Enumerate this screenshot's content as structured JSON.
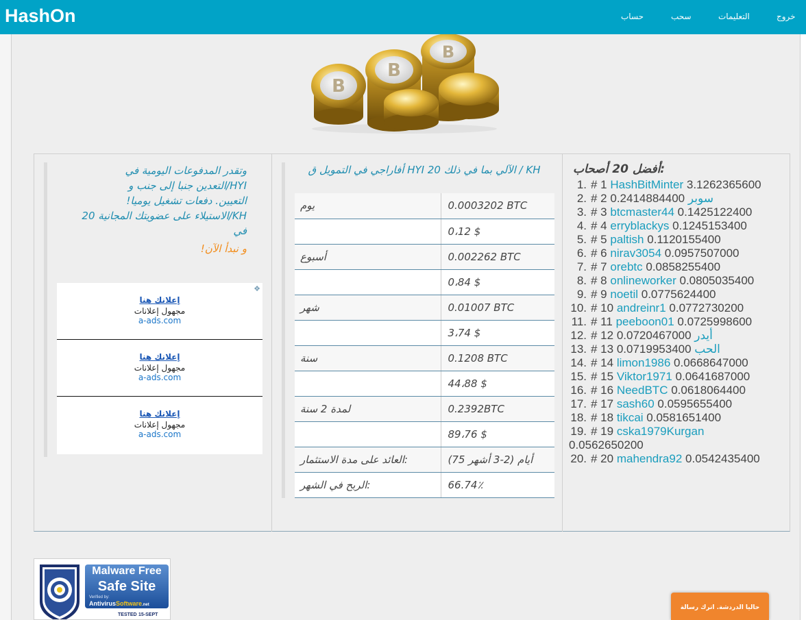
{
  "nav": {
    "brand": "HashOn",
    "links": [
      "خروج",
      "التعليمات",
      "سحب",
      "حساب"
    ]
  },
  "promo": {
    "line1": "وتقدر المدفوعات اليومية في",
    "line2": "HYI/التعدين جنبا إلى جنب و",
    "line3": "التعيين. دفعات تشغيل يوميا!",
    "line4": "KH/الاستيلاء على عضويتك المجانية 20",
    "line5": "في",
    "cta": "و نبدأ الآن!"
  },
  "ads": {
    "items": [
      {
        "title": "إعلانك هنا",
        "subtitle": "مجهول إعلانات",
        "url": "a-ads.com"
      },
      {
        "title": "إعلانك هنا",
        "subtitle": "مجهول إعلانات",
        "url": "a-ads.com"
      },
      {
        "title": "إعلانك هنا",
        "subtitle": "مجهول إعلانات",
        "url": "a-ads.com"
      }
    ]
  },
  "profit": {
    "title": "KH / الآلي بما في ذلك 20 HYI أفاراجي في التمويل ق",
    "rows": [
      {
        "label": "يوم",
        "value": "0.0003202 BTC"
      },
      {
        "label": "",
        "value": "0،12 $"
      },
      {
        "label": "أسبوع",
        "value": "0.002262 BTC"
      },
      {
        "label": "",
        "value": "0،84 $"
      },
      {
        "label": "شهر",
        "value": "0.01007 BTC"
      },
      {
        "label": "",
        "value": "3،74 $"
      },
      {
        "label": "سنة",
        "value": "0.1208 BTC"
      },
      {
        "label": "",
        "value": "44،88 $"
      },
      {
        "label": "لمدة 2 سنة",
        "value": " 0.2392BTC"
      },
      {
        "label": "",
        "value": "89،76 $"
      },
      {
        "label": "العائد على مدة الاستثمار:",
        "value": "(أيام (2-3 أشهر 75"
      },
      {
        "label": "الربح في الشهر:",
        "value": "66.74٪"
      }
    ]
  },
  "top": {
    "title": "أفضل 20 أصحاب:",
    "entries": [
      {
        "num": "1.",
        "rank": "# 1",
        "name": "HashBitMinter",
        "amount": "3.1262365600",
        "order": "name-first"
      },
      {
        "num": "2.",
        "rank": "# 2",
        "name": "سوبر",
        "amount": "0.2414884400",
        "order": "amount-first"
      },
      {
        "num": "3.",
        "rank": "# 3",
        "name": "btcmaster44",
        "amount": "0.1425122400",
        "order": "name-first"
      },
      {
        "num": "4.",
        "rank": "# 4",
        "name": "erryblackys",
        "amount": "0.1245153400",
        "order": "name-first"
      },
      {
        "num": "5.",
        "rank": "# 5",
        "name": "paltish",
        "amount": "0.1120155400",
        "order": "name-first"
      },
      {
        "num": "6.",
        "rank": "# 6",
        "name": "nirav3054",
        "amount": "0.0957507000",
        "order": "name-first"
      },
      {
        "num": "7.",
        "rank": "# 7",
        "name": "orebtc",
        "amount": "0.0858255400",
        "order": "name-first"
      },
      {
        "num": "8.",
        "rank": "# 8",
        "name": "onlineworker",
        "amount": "0.0805035400",
        "order": "name-first"
      },
      {
        "num": "9.",
        "rank": "# 9",
        "name": "noetil",
        "amount": "0.0775624400",
        "order": "name-first"
      },
      {
        "num": "10.",
        "rank": "# 10",
        "name": "andreinr1",
        "amount": "0.0772730200",
        "order": "name-first"
      },
      {
        "num": "11.",
        "rank": "# 11",
        "name": "peeboon01",
        "amount": "0.0725998600",
        "order": "name-first"
      },
      {
        "num": "12.",
        "rank": "# 12",
        "name": "أيدر",
        "amount": "0.0720467000",
        "order": "amount-first"
      },
      {
        "num": "13.",
        "rank": "# 13",
        "name": "الحب",
        "amount": "0.0719953400",
        "order": "amount-first"
      },
      {
        "num": "14.",
        "rank": "# 14",
        "name": "limon1986",
        "amount": "0.0668647000",
        "order": "name-first"
      },
      {
        "num": "15.",
        "rank": "# 15",
        "name": "Viktor1971",
        "amount": "0.0641687000",
        "order": "name-first"
      },
      {
        "num": "16.",
        "rank": "# 16",
        "name": "NeedBTC",
        "amount": "0.0618064400",
        "order": "name-first"
      },
      {
        "num": "17.",
        "rank": "# 17",
        "name": "sash60",
        "amount": "0.0595655400",
        "order": "name-first"
      },
      {
        "num": "18.",
        "rank": "# 18",
        "name": "tikcai",
        "amount": "0.0581651400",
        "order": "name-first"
      },
      {
        "num": "19.",
        "rank": "# 19",
        "name": "cska1979Kurgan",
        "amount": "0.0562650200",
        "order": "name-first"
      },
      {
        "num": "20.",
        "rank": "# 20",
        "name": "mahendra92",
        "amount": "0.0542435400",
        "order": "name-first"
      }
    ]
  },
  "badge": {
    "line1": "Malware Free",
    "line2": "Safe Site",
    "verified": "Verified by:",
    "brand_a": "Antivirus",
    "brand_b": "Software",
    "brand_tld": ".net",
    "tested": "TESTED",
    "date": "15-SEPT"
  },
  "chat": {
    "label": "حاليا الدردشة. اترك رسالة"
  },
  "colors": {
    "navbar": "#01a3c7",
    "link": "#1a9dbd",
    "accent": "#f28c1a",
    "chat": "#f0852d"
  }
}
